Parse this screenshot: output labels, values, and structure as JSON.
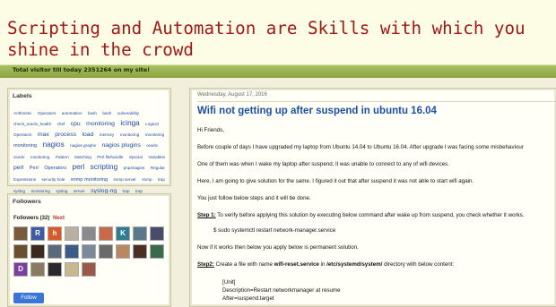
{
  "header": {
    "title": "Scripting and Automation are Skills with which you shine in the crowd",
    "visitor_text": "Total visitor till today 2351264 on my site!"
  },
  "labels": {
    "title": "Labels",
    "tags": [
      {
        "text": "Arithmetic",
        "size": 1
      },
      {
        "text": "Operators",
        "size": 1
      },
      {
        "text": "automation",
        "size": 1
      },
      {
        "text": "bash",
        "size": 1
      },
      {
        "text": "bash",
        "size": 1
      },
      {
        "text": "vulnerability",
        "size": 1
      },
      {
        "text": "check_oracle_health",
        "size": 1
      },
      {
        "text": "chef",
        "size": 1
      },
      {
        "text": "cpu",
        "size": 3
      },
      {
        "text": "monitoring",
        "size": 3
      },
      {
        "text": "icinga",
        "size": 4
      },
      {
        "text": "Logical",
        "size": 1
      },
      {
        "text": "Operators",
        "size": 1
      },
      {
        "text": "max",
        "size": 3
      },
      {
        "text": "process",
        "size": 3
      },
      {
        "text": "load",
        "size": 3
      },
      {
        "text": "memory",
        "size": 1
      },
      {
        "text": "monitoring",
        "size": 1
      },
      {
        "text": "monitoring",
        "size": 1
      },
      {
        "text": "monitoring",
        "size": 2
      },
      {
        "text": "nagios",
        "size": 4
      },
      {
        "text": "nagios graphs",
        "size": 1
      },
      {
        "text": "nagios plugins",
        "size": 3
      },
      {
        "text": "oracle",
        "size": 1
      },
      {
        "text": "oracle",
        "size": 1
      },
      {
        "text": "monitoring",
        "size": 1
      },
      {
        "text": "Pattern",
        "size": 1
      },
      {
        "text": "Matching",
        "size": 1
      },
      {
        "text": "Perl filehandle",
        "size": 1
      },
      {
        "text": "Special",
        "size": 1
      },
      {
        "text": "Variables",
        "size": 1
      },
      {
        "text": "perl",
        "size": 3
      },
      {
        "text": "Perl",
        "size": 2
      },
      {
        "text": "Operators",
        "size": 2
      },
      {
        "text": "perl",
        "size": 4
      },
      {
        "text": "scripting",
        "size": 4
      },
      {
        "text": "pnp4nagios",
        "size": 1
      },
      {
        "text": "Regular",
        "size": 1
      },
      {
        "text": "Expressions",
        "size": 1
      },
      {
        "text": "security hole",
        "size": 1
      },
      {
        "text": "snmp monitoring",
        "size": 2
      },
      {
        "text": "snmp server",
        "size": 1
      },
      {
        "text": "snmp",
        "size": 1
      },
      {
        "text": "trap",
        "size": 1
      },
      {
        "text": "syslog",
        "size": 1
      },
      {
        "text": "monitoring",
        "size": 1
      },
      {
        "text": "syslog",
        "size": 1
      },
      {
        "text": "server",
        "size": 1
      },
      {
        "text": "syslog-ng",
        "size": 3
      },
      {
        "text": "trap",
        "size": 1
      },
      {
        "text": "trap",
        "size": 1
      },
      {
        "text": "monitoring",
        "size": 1
      },
      {
        "text": "windows cpu",
        "size": 1
      }
    ]
  },
  "followers": {
    "title": "Followers",
    "count_label": "Followers (32)",
    "next_label": "Next",
    "avatars": [
      {
        "letter": "",
        "color": "#7a5a3a"
      },
      {
        "letter": "R",
        "color": "#3b5ba8"
      },
      {
        "letter": "h",
        "color": "#d85a28"
      },
      {
        "letter": "",
        "color": "#b8b0a0"
      },
      {
        "letter": "",
        "color": "#8a8a8a"
      },
      {
        "letter": "",
        "color": "#c86a48"
      },
      {
        "letter": "K",
        "color": "#2e7b92"
      },
      {
        "letter": "",
        "color": "#5a7a8a"
      },
      {
        "letter": "",
        "color": "#4a4a6a"
      },
      {
        "letter": "",
        "color": "#6a5030"
      },
      {
        "letter": "",
        "color": "#3a2a20"
      },
      {
        "letter": "",
        "color": "#5a6a7a"
      },
      {
        "letter": "",
        "color": "#3a5a8a"
      },
      {
        "letter": "",
        "color": "#7a8a9a"
      },
      {
        "letter": "",
        "color": "#6a6a6a"
      },
      {
        "letter": "",
        "color": "#b88860"
      },
      {
        "letter": "",
        "color": "#4a3020"
      },
      {
        "letter": "",
        "color": "#3a6a4a"
      },
      {
        "letter": "D",
        "color": "#7b3fa0"
      },
      {
        "letter": "",
        "color": "#8a7a60"
      },
      {
        "letter": "",
        "color": "#2a2a2a"
      },
      {
        "letter": "",
        "color": "#c8b890"
      },
      {
        "letter": "",
        "color": "#9a5a4a"
      }
    ],
    "follow_label": "Follow"
  },
  "post": {
    "date": "Wednesday, August 17, 2016",
    "title": "Wifi not getting up after suspend in ubuntu 16.04",
    "greeting": "Hi Friends,",
    "para1": "Before couple of days I have upgraded my laptop from Ubuntu 14.04 to Ubuntu 16.04. After upgrade I was facing some misbehaviour",
    "para2": "One of them was when I wake my laptop after suspend, it was unable to connect to any of wifi devices.",
    "para3": "Here, I am going to give solution for the same. I figured it out that after suspend it was not able to start wifi again.",
    "para4": "You just follow below steps and it will be done.",
    "step1_label": "Step 1:",
    "step1_text": " To verify before applying this solution by executing below command after wake up from suspend, you check whether it works.",
    "command1": "$ sudo systemctl restart network-manager.service",
    "para5": "Now if it works then below you apply below is permanent solution.",
    "step2_label": "Step2:",
    "step2_pre": " Create a file with name ",
    "step2_file": "wifi-reset.service",
    "step2_mid": " in ",
    "step2_dir": "/etc/systemd/system/",
    "step2_post": " directory with below content:",
    "code1": "[Unit]",
    "code2": "Description=Restart networkmanager at resume",
    "code3": "After=suspend.target"
  }
}
